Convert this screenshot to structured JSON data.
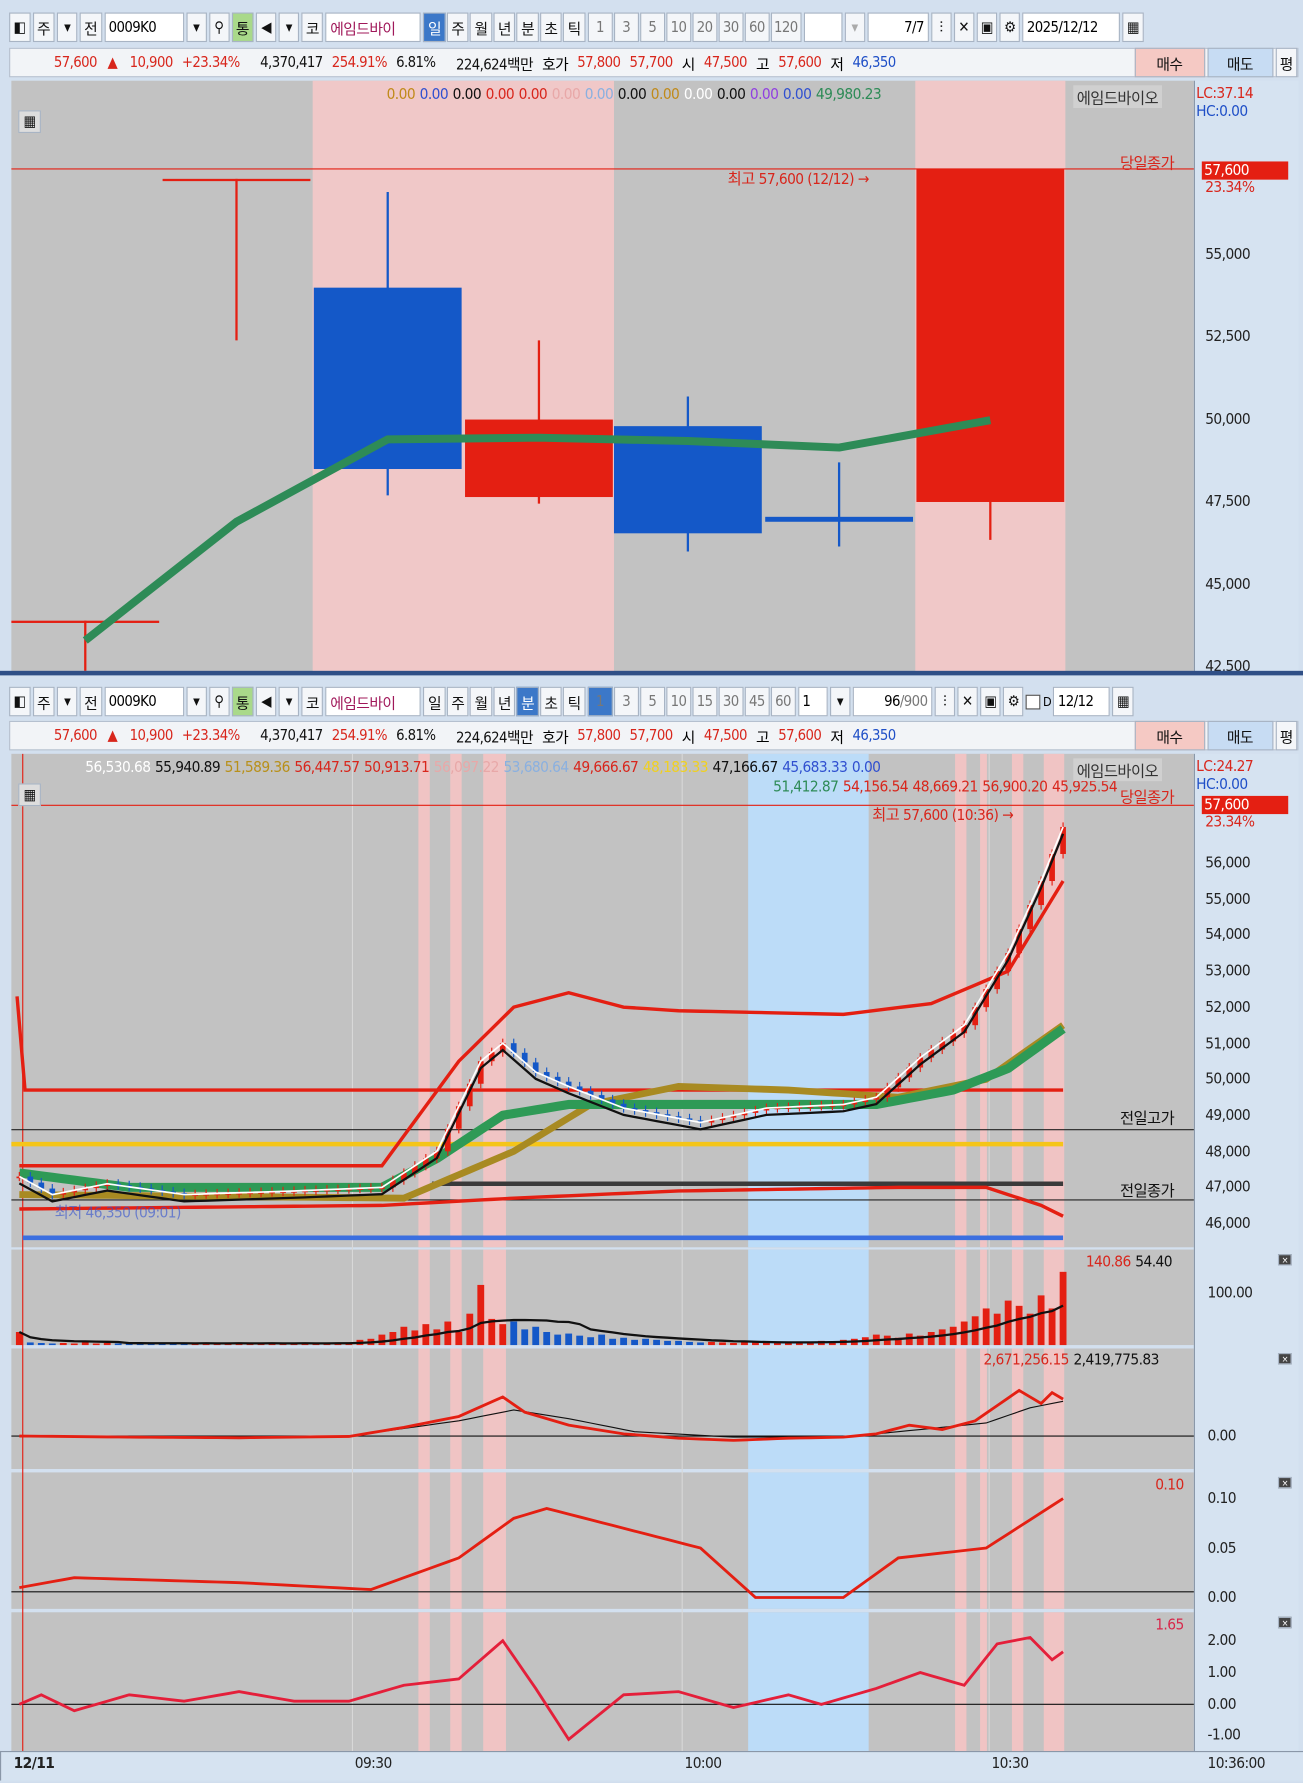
{
  "toolbar_daily": {
    "mode": "주",
    "prev": "전",
    "code": "0009K0",
    "tong": "통",
    "market": "코",
    "name": "에임드바이",
    "periods": [
      "일",
      "주",
      "월",
      "년",
      "분",
      "초",
      "틱"
    ],
    "active_period": "일",
    "intervals": [
      "1",
      "3",
      "5",
      "10",
      "20",
      "30",
      "60",
      "120"
    ],
    "count": "7/7",
    "date": "2025/12/12"
  },
  "toolbar_minute": {
    "mode": "주",
    "prev": "전",
    "code": "0009K0",
    "tong": "통",
    "market": "코",
    "name": "에임드바이",
    "periods": [
      "일",
      "주",
      "월",
      "년",
      "분",
      "초",
      "틱"
    ],
    "active_period": "분",
    "intervals": [
      "1",
      "3",
      "5",
      "10",
      "15",
      "30",
      "45",
      "60"
    ],
    "active_interval": "1",
    "select": "1",
    "count": "96",
    "count_total": "/900",
    "check_label": "D",
    "date": "12/12"
  },
  "quote": {
    "price": "57,600",
    "arrow": "▲",
    "change": "10,900",
    "pct": "+23.34%",
    "volume": "4,370,417",
    "vol_ratio": "254.91%",
    "turnover": "6.81%",
    "amount": "224,624백만",
    "ask_label": "호가",
    "ask": "57,800",
    "bid": "57,700",
    "open_label": "시",
    "open": "47,500",
    "high_label": "고",
    "high": "57,600",
    "low_label": "저",
    "low": "46,350",
    "buy": "매수",
    "sell": "매도",
    "eval": "평"
  },
  "daily_chart": {
    "legend": [
      {
        "t": "0.00",
        "c": "#c08a1a"
      },
      {
        "t": "0.00",
        "c": "#3050d0"
      },
      {
        "t": "0.00",
        "c": "#111"
      },
      {
        "t": "0.00",
        "c": "#d8261c"
      },
      {
        "t": "0.00",
        "c": "#d8261c"
      },
      {
        "t": "0.00",
        "c": "#e8a8a8"
      },
      {
        "t": "0.00",
        "c": "#8ab0e0"
      },
      {
        "t": "0.00",
        "c": "#111"
      },
      {
        "t": "0.00",
        "c": "#c08a1a"
      },
      {
        "t": "0.00",
        "c": "#fff"
      },
      {
        "t": "0.00",
        "c": "#111"
      },
      {
        "t": "0.00",
        "c": "#9040e0"
      },
      {
        "t": "0.00",
        "c": "#3050d0"
      },
      {
        "t": "49,980.23",
        "c": "#2e8b57"
      }
    ],
    "stock_name": "에임드바이오",
    "lc": "LC:37.14",
    "hc": "HC:0.00",
    "prev_close_label": "당일종가",
    "high_note": "최고 57,600 (12/12) →",
    "last_price": "57,600",
    "last_pct": "23.34%",
    "y_ticks": [
      "55,000",
      "52,500",
      "50,000",
      "47,500",
      "45,000",
      "42,500"
    ],
    "candles": [
      {
        "o": 43900,
        "h": 43900,
        "l": 42000,
        "c": 43900
      },
      {
        "o": 57300,
        "h": 57300,
        "l": 52400,
        "c": 57300
      },
      {
        "o": 54000,
        "h": 56900,
        "l": 47700,
        "c": 48500
      },
      {
        "o": 47650,
        "h": 52400,
        "l": 47450,
        "c": 50000
      },
      {
        "o": 49800,
        "h": 50700,
        "l": 46000,
        "c": 46550
      },
      {
        "o": 47050,
        "h": 48700,
        "l": 46150,
        "c": 46900
      },
      {
        "o": 47500,
        "h": 57600,
        "l": 46350,
        "c": 57600
      }
    ],
    "ma": [
      43300,
      46900,
      49400,
      49450,
      49350,
      49150,
      49980
    ]
  },
  "minute_chart": {
    "legend1": [
      {
        "t": "56,530.68",
        "c": "#fff"
      },
      {
        "t": "55,940.89",
        "c": "#111"
      },
      {
        "t": "51,589.36",
        "c": "#b8901a"
      },
      {
        "t": "56,447.57",
        "c": "#d8261c"
      },
      {
        "t": "50,913.71",
        "c": "#d8261c"
      },
      {
        "t": "56,097.22",
        "c": "#e8a8a8"
      },
      {
        "t": "53,680.64",
        "c": "#8ab0e0"
      },
      {
        "t": "49,666.67",
        "c": "#d8261c"
      },
      {
        "t": "48,183.33",
        "c": "#f0d020"
      },
      {
        "t": "47,166.67",
        "c": "#111"
      },
      {
        "t": "45,683.33",
        "c": "#3050d0"
      },
      {
        "t": "0.00",
        "c": "#3050d0"
      }
    ],
    "legend2": [
      {
        "t": "51,412.87",
        "c": "#2e8b57"
      },
      {
        "t": "54,156.54",
        "c": "#d8261c"
      },
      {
        "t": "48,669.21",
        "c": "#d8261c"
      },
      {
        "t": "56,900.20",
        "c": "#d8261c"
      },
      {
        "t": "45,925.54",
        "c": "#d8261c"
      }
    ],
    "stock_name": "에임드바이오",
    "lc": "LC:24.27",
    "hc": "HC:0.00",
    "prev_close_label": "당일종가",
    "prev_high_line": "전일고가",
    "prev_close_line": "전일종가",
    "high_note": "최고 57,600 (10:36) →",
    "low_note": "최저 46,350 (09:01)",
    "last_price": "57,600",
    "last_pct": "23.34%",
    "y_ticks": [
      "56,000",
      "55,000",
      "54,000",
      "53,000",
      "52,000",
      "51,000",
      "50,000",
      "49,000",
      "48,000",
      "47,000",
      "46,000"
    ],
    "close_kp": [
      [
        0,
        47300
      ],
      [
        3,
        46800
      ],
      [
        8,
        47100
      ],
      [
        15,
        46800
      ],
      [
        25,
        46900
      ],
      [
        33,
        47000
      ],
      [
        38,
        48000
      ],
      [
        42,
        50500
      ],
      [
        44,
        51000
      ],
      [
        47,
        50200
      ],
      [
        50,
        49800
      ],
      [
        55,
        49200
      ],
      [
        62,
        48800
      ],
      [
        68,
        49200
      ],
      [
        75,
        49300
      ],
      [
        78,
        49500
      ],
      [
        82,
        50600
      ],
      [
        86,
        51500
      ],
      [
        90,
        53500
      ],
      [
        93,
        55500
      ],
      [
        95,
        57000
      ]
    ],
    "ma_green_kp": [
      [
        0,
        47400
      ],
      [
        10,
        47000
      ],
      [
        33,
        47000
      ],
      [
        38,
        47800
      ],
      [
        42,
        48600
      ],
      [
        44,
        49000
      ],
      [
        50,
        49300
      ],
      [
        70,
        49300
      ],
      [
        78,
        49300
      ],
      [
        85,
        49700
      ],
      [
        90,
        50300
      ],
      [
        95,
        51400
      ]
    ],
    "ma_olive_kp": [
      [
        0,
        46800
      ],
      [
        35,
        46700
      ],
      [
        45,
        48000
      ],
      [
        52,
        49300
      ],
      [
        60,
        49800
      ],
      [
        70,
        49700
      ],
      [
        80,
        49500
      ],
      [
        88,
        50000
      ],
      [
        95,
        51500
      ]
    ],
    "band_upper_kp": [
      [
        0,
        47600
      ],
      [
        33,
        47600
      ],
      [
        40,
        50500
      ],
      [
        45,
        52000
      ],
      [
        50,
        52400
      ],
      [
        55,
        52000
      ],
      [
        60,
        51900
      ],
      [
        75,
        51800
      ],
      [
        83,
        52100
      ],
      [
        90,
        53000
      ],
      [
        95,
        55500
      ]
    ],
    "band_lower_kp": [
      [
        0,
        46400
      ],
      [
        33,
        46500
      ],
      [
        45,
        46700
      ],
      [
        60,
        46900
      ],
      [
        80,
        47000
      ],
      [
        88,
        47000
      ],
      [
        93,
        46500
      ],
      [
        95,
        46200
      ]
    ],
    "levels": {
      "red": 49700,
      "yellow": 48200,
      "dark": 47100,
      "blue": 45600,
      "prev_high": 48600,
      "prev_close": 46650,
      "day_high": 57600
    }
  },
  "volume": {
    "legend": [
      {
        "t": "140.86",
        "c": "#d8261c"
      },
      {
        "t": "54.40",
        "c": "#111"
      }
    ],
    "y_ticks": [
      "100.00"
    ],
    "values": [
      25,
      5,
      4,
      3,
      4,
      3,
      5,
      3,
      4,
      3,
      3,
      4,
      3,
      3,
      4,
      3,
      3,
      4,
      3,
      3,
      4,
      3,
      3,
      4,
      3,
      3,
      4,
      3,
      3,
      4,
      5,
      10,
      12,
      20,
      25,
      35,
      28,
      40,
      30,
      45,
      25,
      60,
      115,
      50,
      40,
      45,
      30,
      35,
      25,
      20,
      22,
      18,
      15,
      20,
      12,
      14,
      10,
      12,
      10,
      8,
      8,
      6,
      5,
      6,
      5,
      4,
      6,
      5,
      5,
      4,
      6,
      5,
      6,
      8,
      7,
      10,
      12,
      15,
      20,
      18,
      14,
      22,
      18,
      25,
      30,
      35,
      45,
      55,
      70,
      60,
      85,
      75,
      60,
      95,
      70,
      140
    ]
  },
  "macd": {
    "legend": [
      {
        "t": "2,671,256.15",
        "c": "#d8261c"
      },
      {
        "t": "2,419,775.83",
        "c": "#111"
      }
    ],
    "y_ticks": [
      "0.00"
    ],
    "main_kp": [
      [
        0,
        0
      ],
      [
        10,
        -50
      ],
      [
        20,
        -80
      ],
      [
        30,
        -20
      ],
      [
        35,
        400
      ],
      [
        40,
        900
      ],
      [
        44,
        1800
      ],
      [
        46,
        1100
      ],
      [
        50,
        500
      ],
      [
        55,
        100
      ],
      [
        60,
        -100
      ],
      [
        65,
        -200
      ],
      [
        70,
        -100
      ],
      [
        75,
        -50
      ],
      [
        78,
        100
      ],
      [
        81,
        500
      ],
      [
        84,
        300
      ],
      [
        87,
        700
      ],
      [
        89,
        1400
      ],
      [
        91,
        2100
      ],
      [
        93,
        1500
      ],
      [
        94,
        2000
      ],
      [
        95,
        1700
      ]
    ],
    "signal_kp": [
      [
        0,
        0
      ],
      [
        30,
        0
      ],
      [
        40,
        700
      ],
      [
        45,
        1200
      ],
      [
        50,
        800
      ],
      [
        56,
        200
      ],
      [
        65,
        -50
      ],
      [
        75,
        -50
      ],
      [
        82,
        300
      ],
      [
        88,
        600
      ],
      [
        92,
        1300
      ],
      [
        95,
        1600
      ]
    ]
  },
  "ind4": {
    "legend": "0.10",
    "y_ticks": [
      "0.10",
      "0.05",
      "0.00"
    ],
    "kp": [
      [
        0,
        0.01
      ],
      [
        5,
        0.02
      ],
      [
        20,
        0.015
      ],
      [
        32,
        0.008
      ],
      [
        40,
        0.04
      ],
      [
        45,
        0.08
      ],
      [
        48,
        0.09
      ],
      [
        55,
        0.07
      ],
      [
        62,
        0.05
      ],
      [
        67,
        0.0
      ],
      [
        75,
        0.0
      ],
      [
        80,
        0.04
      ],
      [
        88,
        0.05
      ],
      [
        95,
        0.1
      ]
    ]
  },
  "ind5": {
    "legend": "1.65",
    "y_ticks": [
      "2.00",
      "1.00",
      "0.00",
      "-1.00"
    ],
    "kp": [
      [
        0,
        0
      ],
      [
        2,
        0.3
      ],
      [
        5,
        -0.2
      ],
      [
        10,
        0.3
      ],
      [
        15,
        0.1
      ],
      [
        20,
        0.4
      ],
      [
        25,
        0.1
      ],
      [
        30,
        0.1
      ],
      [
        35,
        0.6
      ],
      [
        40,
        0.8
      ],
      [
        44,
        2.0
      ],
      [
        47,
        0.5
      ],
      [
        50,
        -1.1
      ],
      [
        55,
        0.3
      ],
      [
        60,
        0.4
      ],
      [
        65,
        -0.1
      ],
      [
        70,
        0.3
      ],
      [
        73,
        0
      ],
      [
        78,
        0.5
      ],
      [
        82,
        1.0
      ],
      [
        86,
        0.6
      ],
      [
        89,
        1.9
      ],
      [
        92,
        2.1
      ],
      [
        94,
        1.4
      ],
      [
        95,
        1.65
      ]
    ]
  },
  "x_axis": {
    "date": "12/11",
    "ticks": [
      "09:30",
      "10:00",
      "10:30"
    ],
    "end": "10:36:00"
  },
  "colors": {
    "up": "#e41f12",
    "down": "#1458c8",
    "ma": "#2e8b57"
  }
}
